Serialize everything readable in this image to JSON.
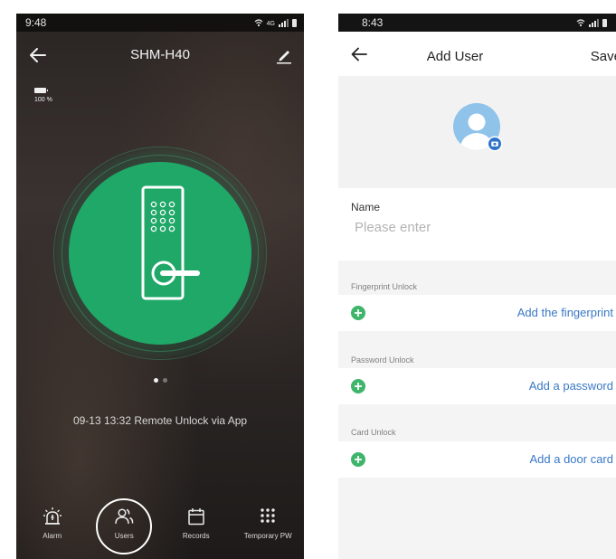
{
  "left_screen": {
    "status_time": "9:48",
    "status_network": "4G",
    "title": "SHM-H40",
    "battery_percent": "100 %",
    "pager": {
      "total": 2,
      "active": 1
    },
    "last_record": "09-13 13:32  Remote Unlock via App",
    "nav": [
      {
        "label": "Alarm",
        "icon": "alarm-icon",
        "active": false
      },
      {
        "label": "Users",
        "icon": "users-icon",
        "active": true
      },
      {
        "label": "Records",
        "icon": "calendar-icon",
        "active": false
      },
      {
        "label": "Temporary PW",
        "icon": "keypad-icon",
        "active": false
      }
    ],
    "colors": {
      "accent_green": "#20a868"
    }
  },
  "right_screen": {
    "status_time": "8:43",
    "title": "Add User",
    "save_label": "Save",
    "name": {
      "label": "Name",
      "value": "",
      "placeholder": "Please enter"
    },
    "sections": [
      {
        "caption": "Fingerprint Unlock",
        "action": "Add the fingerprint"
      },
      {
        "caption": "Password Unlock",
        "action": "Add a password"
      },
      {
        "caption": "Card Unlock",
        "action": "Add a door card"
      }
    ],
    "colors": {
      "link_blue": "#3a78c4",
      "plus_green": "#3fb56b",
      "avatar_blue": "#8fc3ea",
      "camera_badge": "#2f73c9"
    }
  }
}
